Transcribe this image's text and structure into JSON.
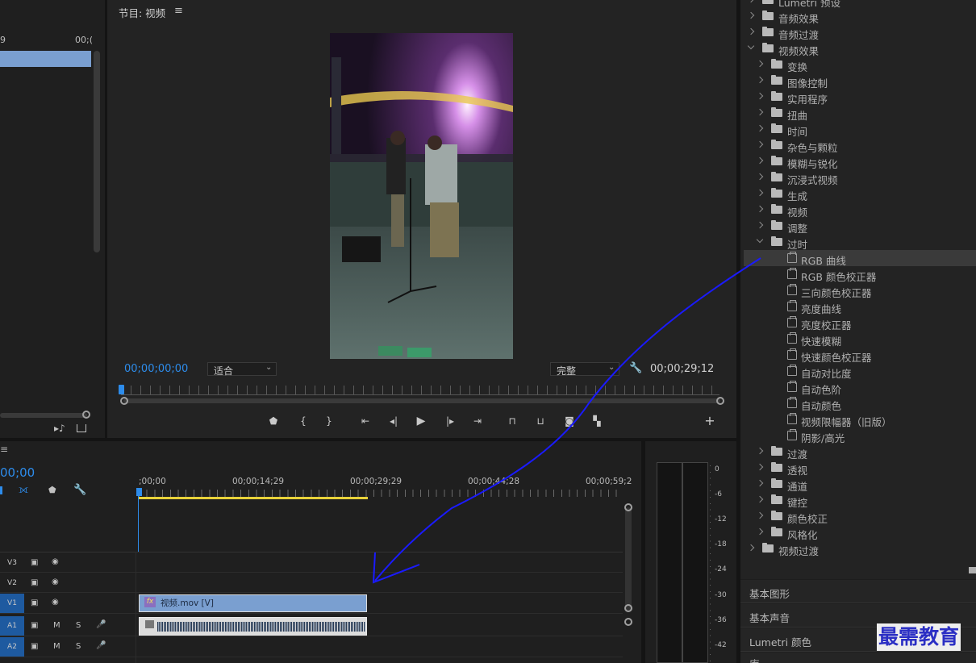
{
  "program_monitor": {
    "title": "节目: 视频",
    "timecode_current": "00;00;00;00",
    "timecode_duration": "00;00;29;12",
    "zoom_select": "适合",
    "quality_select": "完整"
  },
  "source_panel": {
    "ruler_left": "9",
    "ruler_right": "00;("
  },
  "timeline": {
    "timecode": "00;00",
    "ruler_labels": [
      ";00;00",
      "00;00;14;29",
      "00;00;29;29",
      "00;00;44;28",
      "00;00;59;2"
    ],
    "tracks": [
      {
        "id": "V3",
        "type": "video"
      },
      {
        "id": "V2",
        "type": "video"
      },
      {
        "id": "V1",
        "type": "video"
      },
      {
        "id": "A1",
        "type": "audio",
        "m": "M",
        "s": "S"
      },
      {
        "id": "A2",
        "type": "audio",
        "m": "M",
        "s": "S"
      }
    ],
    "clip_video_label": "视频.mov [V]",
    "clip_badge": "fx"
  },
  "meter": {
    "scale": [
      "0",
      "-6",
      "-12",
      "-18",
      "-24",
      "-30",
      "-36",
      "-42"
    ]
  },
  "effects_tree": {
    "items": [
      {
        "label": "Lumetri 预设",
        "level": 0,
        "kind": "folder",
        "open": false
      },
      {
        "label": "音频效果",
        "level": 0,
        "kind": "folder",
        "open": false
      },
      {
        "label": "音频过渡",
        "level": 0,
        "kind": "folder",
        "open": false
      },
      {
        "label": "视频效果",
        "level": 0,
        "kind": "folder",
        "open": true
      },
      {
        "label": "变换",
        "level": 1,
        "kind": "folder",
        "open": false
      },
      {
        "label": "图像控制",
        "level": 1,
        "kind": "folder",
        "open": false
      },
      {
        "label": "实用程序",
        "level": 1,
        "kind": "folder",
        "open": false
      },
      {
        "label": "扭曲",
        "level": 1,
        "kind": "folder",
        "open": false
      },
      {
        "label": "时间",
        "level": 1,
        "kind": "folder",
        "open": false
      },
      {
        "label": "杂色与颗粒",
        "level": 1,
        "kind": "folder",
        "open": false
      },
      {
        "label": "模糊与锐化",
        "level": 1,
        "kind": "folder",
        "open": false
      },
      {
        "label": "沉浸式视频",
        "level": 1,
        "kind": "folder",
        "open": false
      },
      {
        "label": "生成",
        "level": 1,
        "kind": "folder",
        "open": false
      },
      {
        "label": "视频",
        "level": 1,
        "kind": "folder",
        "open": false
      },
      {
        "label": "调整",
        "level": 1,
        "kind": "folder",
        "open": false
      },
      {
        "label": "过时",
        "level": 1,
        "kind": "folder",
        "open": true
      },
      {
        "label": "RGB 曲线",
        "level": 2,
        "kind": "effect",
        "selected": true
      },
      {
        "label": "RGB 颜色校正器",
        "level": 2,
        "kind": "effect"
      },
      {
        "label": "三向颜色校正器",
        "level": 2,
        "kind": "effect"
      },
      {
        "label": "亮度曲线",
        "level": 2,
        "kind": "effect"
      },
      {
        "label": "亮度校正器",
        "level": 2,
        "kind": "effect"
      },
      {
        "label": "快速模糊",
        "level": 2,
        "kind": "effect"
      },
      {
        "label": "快速颜色校正器",
        "level": 2,
        "kind": "effect"
      },
      {
        "label": "自动对比度",
        "level": 2,
        "kind": "effect"
      },
      {
        "label": "自动色阶",
        "level": 2,
        "kind": "effect"
      },
      {
        "label": "自动颜色",
        "level": 2,
        "kind": "effect"
      },
      {
        "label": "视频限幅器（旧版）",
        "level": 2,
        "kind": "effect"
      },
      {
        "label": "阴影/高光",
        "level": 2,
        "kind": "effect"
      },
      {
        "label": "过渡",
        "level": 1,
        "kind": "folder",
        "open": false
      },
      {
        "label": "透视",
        "level": 1,
        "kind": "folder",
        "open": false
      },
      {
        "label": "通道",
        "level": 1,
        "kind": "folder",
        "open": false
      },
      {
        "label": "键控",
        "level": 1,
        "kind": "folder",
        "open": false
      },
      {
        "label": "颜色校正",
        "level": 1,
        "kind": "folder",
        "open": false
      },
      {
        "label": "风格化",
        "level": 1,
        "kind": "folder",
        "open": false
      },
      {
        "label": "视频过渡",
        "level": 0,
        "kind": "folder",
        "open": false
      }
    ]
  },
  "side_panels": [
    "基本图形",
    "基本声音",
    "Lumetri 颜色",
    "库"
  ],
  "watermark": "最需教育",
  "colors": {
    "accent_blue": "#2d8ceb",
    "clip_video": "#7a9fd0",
    "work_area": "#e8d23a",
    "annotation": "#1a1aff"
  }
}
